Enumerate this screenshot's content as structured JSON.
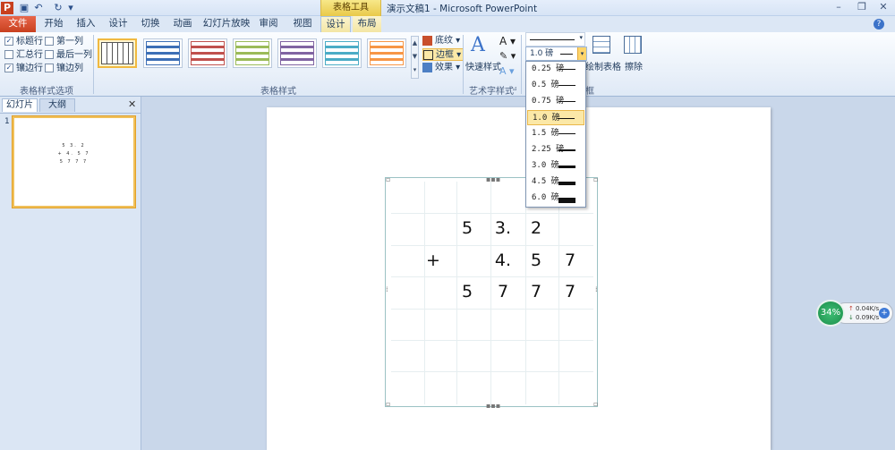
{
  "titlebar": {
    "quick_access": [
      "save-icon",
      "undo-icon",
      "redo-icon",
      "customize-icon"
    ],
    "context_group": "表格工具",
    "doc_title": "演示文稿1 - Microsoft PowerPoint",
    "win_buttons": [
      "–",
      "❐",
      "✕"
    ]
  },
  "tabs": {
    "file": "文件",
    "items": [
      "开始",
      "插入",
      "设计",
      "切换",
      "动画",
      "幻灯片放映",
      "审阅",
      "视图",
      "设计",
      "布局"
    ],
    "active_index": 8
  },
  "ribbon": {
    "table_style_options": {
      "label": "表格样式选项",
      "checkboxes": [
        {
          "label": "标题行",
          "checked": true
        },
        {
          "label": "第一列",
          "checked": false
        },
        {
          "label": "汇总行",
          "checked": false
        },
        {
          "label": "最后一列",
          "checked": false
        },
        {
          "label": "镶边行",
          "checked": true
        },
        {
          "label": "镶边列",
          "checked": false
        }
      ]
    },
    "table_styles": {
      "label": "表格样式",
      "swatch_colors": [
        "#555555",
        "#3d6fb6",
        "#c0504d",
        "#9bbb59",
        "#8064a2",
        "#4bacc6",
        "#f79646"
      ],
      "shading": "底纹",
      "border": "边框",
      "effects": "效果"
    },
    "wordart": {
      "label": "艺术字样式",
      "quick_styles": "快速样式"
    },
    "draw_borders": {
      "label": "绘图边框",
      "draw_table": "绘制表格",
      "eraser": "擦除"
    }
  },
  "pane": {
    "tab_slides": "幻灯片",
    "tab_outline": "大纲",
    "slide_number": "1",
    "thumb_rows": [
      "5 3. 2",
      "+ 4. 5 7",
      "5 7 7 7"
    ]
  },
  "table": {
    "rows": [
      [
        "",
        "",
        "5",
        "3.",
        "2",
        ""
      ],
      [
        "",
        "+",
        "",
        "4.",
        "5",
        "7"
      ],
      [
        "",
        "",
        "5",
        "7",
        "7",
        "7"
      ]
    ]
  },
  "border_weight": {
    "current": "1.0 磅",
    "options": [
      {
        "label": "0.25 磅",
        "weight": 0.25
      },
      {
        "label": "0.5 磅",
        "weight": 0.5
      },
      {
        "label": "0.75 磅",
        "weight": 0.75
      },
      {
        "label": "1.0 磅",
        "weight": 1.0
      },
      {
        "label": "1.5 磅",
        "weight": 1.5
      },
      {
        "label": "2.25 磅",
        "weight": 2.25
      },
      {
        "label": "3.0 磅",
        "weight": 3.0
      },
      {
        "label": "4.5 磅",
        "weight": 4.5
      },
      {
        "label": "6.0 磅",
        "weight": 6.0
      }
    ],
    "selected_index": 3
  },
  "net_widget": {
    "percent": "34%",
    "up": "0.04K/s",
    "down": "0.09K/s"
  }
}
